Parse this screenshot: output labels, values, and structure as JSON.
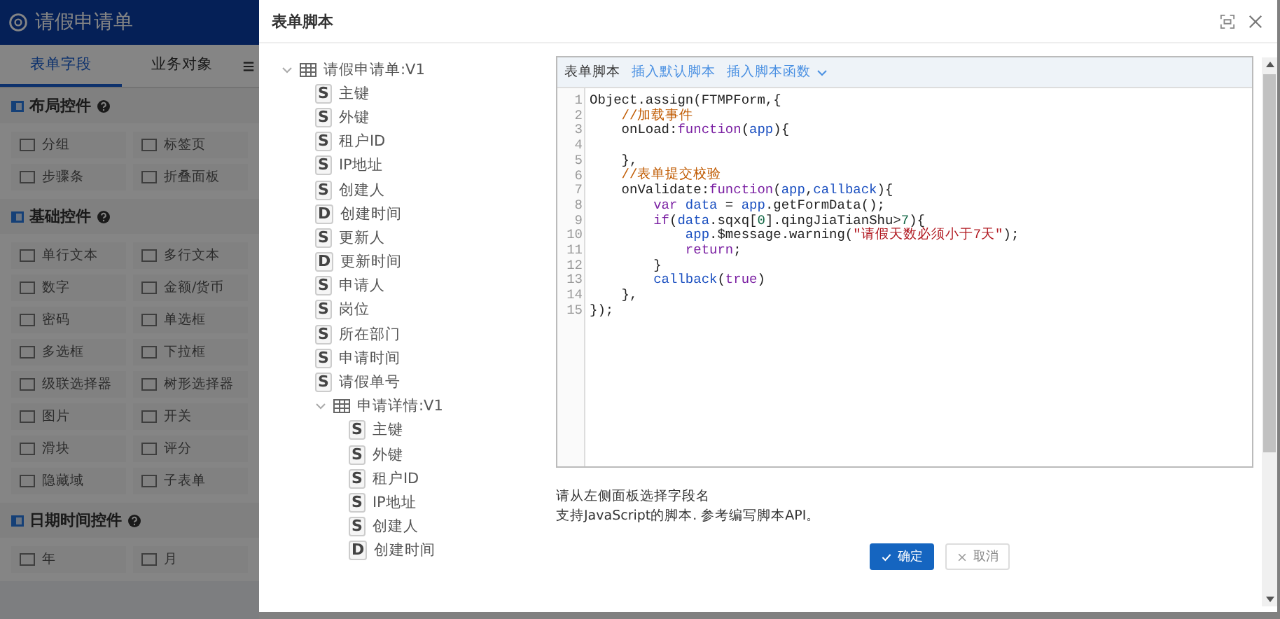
{
  "app": {
    "title": "请假申请单",
    "tabs": [
      {
        "label": "表单字段",
        "selected": true
      },
      {
        "label": "业务对象",
        "selected": false
      }
    ],
    "sections": [
      {
        "title": "布局控件",
        "items": [
          "分组",
          "标签页",
          "步骤条",
          "折叠面板"
        ]
      },
      {
        "title": "基础控件",
        "items": [
          "单行文本",
          "多行文本",
          "数字",
          "金额/货币",
          "密码",
          "单选框",
          "多选框",
          "下拉框",
          "级联选择器",
          "树形选择器",
          "图片",
          "开关",
          "滑块",
          "评分",
          "隐藏域",
          "子表单"
        ]
      },
      {
        "title": "日期时间控件",
        "items": [
          "年",
          "月"
        ]
      }
    ]
  },
  "dialog": {
    "title": "表单脚本",
    "tree": [
      {
        "label": "请假申请单:V1",
        "expanded": true,
        "children": [
          {
            "type": "S",
            "label": "主键"
          },
          {
            "type": "S",
            "label": "外键"
          },
          {
            "type": "S",
            "label": "租户ID"
          },
          {
            "type": "S",
            "label": "IP地址"
          },
          {
            "type": "S",
            "label": "创建人"
          },
          {
            "type": "D",
            "label": "创建时间"
          },
          {
            "type": "S",
            "label": "更新人"
          },
          {
            "type": "D",
            "label": "更新时间"
          },
          {
            "type": "S",
            "label": "申请人"
          },
          {
            "type": "S",
            "label": "岗位"
          },
          {
            "type": "S",
            "label": "所在部门"
          },
          {
            "type": "S",
            "label": "申请时间"
          },
          {
            "type": "S",
            "label": "请假单号"
          },
          {
            "label": "申请详情:V1",
            "expanded": true,
            "children": [
              {
                "type": "S",
                "label": "主键"
              },
              {
                "type": "S",
                "label": "外键"
              },
              {
                "type": "S",
                "label": "租户ID"
              },
              {
                "type": "S",
                "label": "IP地址"
              },
              {
                "type": "S",
                "label": "创建人"
              },
              {
                "type": "D",
                "label": "创建时间"
              }
            ]
          }
        ]
      }
    ],
    "editor": {
      "title": "表单脚本",
      "links": [
        "插入默认脚本",
        "插入脚本函数"
      ],
      "lines": [
        {
          "number": "1",
          "tokens": [
            {
              "kind": "plain",
              "text": "Object.assign(FTMPForm,{"
            }
          ]
        },
        {
          "number": "2",
          "tokens": [
            {
              "kind": "comment",
              "text": "    //加载事件"
            }
          ]
        },
        {
          "number": "3",
          "tokens": [
            {
              "kind": "plain",
              "text": "    onLoad:"
            },
            {
              "kind": "keyword",
              "text": "function"
            },
            {
              "kind": "plain",
              "text": "("
            },
            {
              "kind": "variable",
              "text": "app"
            },
            {
              "kind": "plain",
              "text": "){"
            }
          ]
        },
        {
          "number": "4"
        },
        {
          "number": "5",
          "tokens": [
            {
              "kind": "plain",
              "text": "    },"
            }
          ]
        },
        {
          "number": "6",
          "tokens": [
            {
              "kind": "comment",
              "text": "    //表单提交校验"
            }
          ]
        },
        {
          "number": "7",
          "tokens": [
            {
              "kind": "plain",
              "text": "    onValidate:"
            },
            {
              "kind": "keyword",
              "text": "function"
            },
            {
              "kind": "plain",
              "text": "("
            },
            {
              "kind": "variable",
              "text": "app"
            },
            {
              "kind": "plain",
              "text": ","
            },
            {
              "kind": "variable",
              "text": "callback"
            },
            {
              "kind": "plain",
              "text": "){"
            }
          ]
        },
        {
          "number": "8",
          "tokens": [
            {
              "kind": "keyword",
              "text": "        var "
            },
            {
              "kind": "variable",
              "text": "data"
            },
            {
              "kind": "plain",
              "text": " = "
            },
            {
              "kind": "variable",
              "text": "app"
            },
            {
              "kind": "plain",
              "text": ".getFormData();"
            }
          ]
        },
        {
          "number": "9",
          "tokens": [
            {
              "kind": "keyword",
              "text": "        if"
            },
            {
              "kind": "plain",
              "text": "("
            },
            {
              "kind": "variable",
              "text": "data"
            },
            {
              "kind": "plain",
              "text": ".sqxq["
            },
            {
              "kind": "number",
              "text": "0"
            },
            {
              "kind": "plain",
              "text": "].qingJiaTianShu>"
            },
            {
              "kind": "number",
              "text": "7"
            },
            {
              "kind": "plain",
              "text": "){"
            }
          ]
        },
        {
          "number": "10",
          "tokens": [
            {
              "kind": "variable",
              "text": "            app"
            },
            {
              "kind": "plain",
              "text": ".$message.warning("
            },
            {
              "kind": "string",
              "text": "\"请假天数必须小于7天\""
            },
            {
              "kind": "plain",
              "text": ");"
            }
          ]
        },
        {
          "number": "11",
          "tokens": [
            {
              "kind": "keyword",
              "text": "            return"
            },
            {
              "kind": "plain",
              "text": ";"
            }
          ]
        },
        {
          "number": "12",
          "tokens": [
            {
              "kind": "plain",
              "text": "        }"
            }
          ]
        },
        {
          "number": "13",
          "tokens": [
            {
              "kind": "variable",
              "text": "        callback"
            },
            {
              "kind": "plain",
              "text": "("
            },
            {
              "kind": "keyword",
              "text": "true"
            },
            {
              "kind": "plain",
              "text": ")"
            }
          ]
        },
        {
          "number": "14",
          "tokens": [
            {
              "kind": "plain",
              "text": "    },"
            }
          ]
        },
        {
          "number": "15",
          "tokens": [
            {
              "kind": "plain",
              "text": "});"
            }
          ]
        }
      ]
    },
    "hints": [
      "请从左侧面板选择字段名",
      "支持JavaScript的脚本. 参考编写脚本API。"
    ],
    "buttons": [
      {
        "label": "确定",
        "kind": "primary"
      },
      {
        "label": "取消",
        "kind": "default"
      }
    ]
  }
}
